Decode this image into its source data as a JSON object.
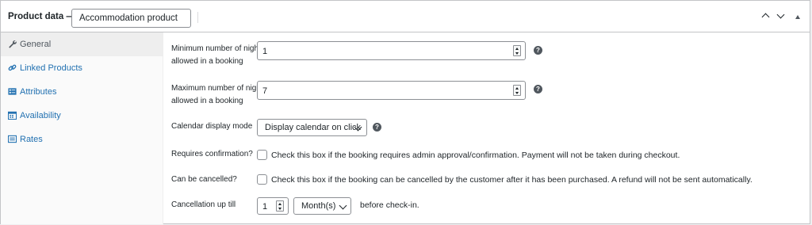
{
  "header": {
    "title": "Product data —",
    "product_type": "Accommodation product"
  },
  "sidebar": {
    "items": [
      {
        "label": "General",
        "icon": "wrench-icon"
      },
      {
        "label": "Linked Products",
        "icon": "link-icon"
      },
      {
        "label": "Attributes",
        "icon": "list-icon"
      },
      {
        "label": "Availability",
        "icon": "calendar-icon"
      },
      {
        "label": "Rates",
        "icon": "rates-icon"
      }
    ]
  },
  "fields": {
    "min_nights": {
      "label_1": "Minimum number of nights",
      "label_2": "allowed in a booking",
      "value": "1"
    },
    "max_nights": {
      "label_1": "Maximum number of nights",
      "label_2": "allowed in a booking",
      "value": "7"
    },
    "calendar_mode": {
      "label": "Calendar display mode",
      "value": "Display calendar on click"
    },
    "requires_confirmation": {
      "label": "Requires confirmation?",
      "description": "Check this box if the booking requires admin approval/confirmation. Payment will not be taken during checkout."
    },
    "can_cancel": {
      "label": "Can be cancelled?",
      "description": "Check this box if the booking can be cancelled by the customer after it has been purchased. A refund will not be sent automatically."
    },
    "cancellation": {
      "label": "Cancellation up till",
      "value": "1",
      "unit": "Month(s)",
      "suffix": "before check-in."
    }
  },
  "help_glyph": "?"
}
